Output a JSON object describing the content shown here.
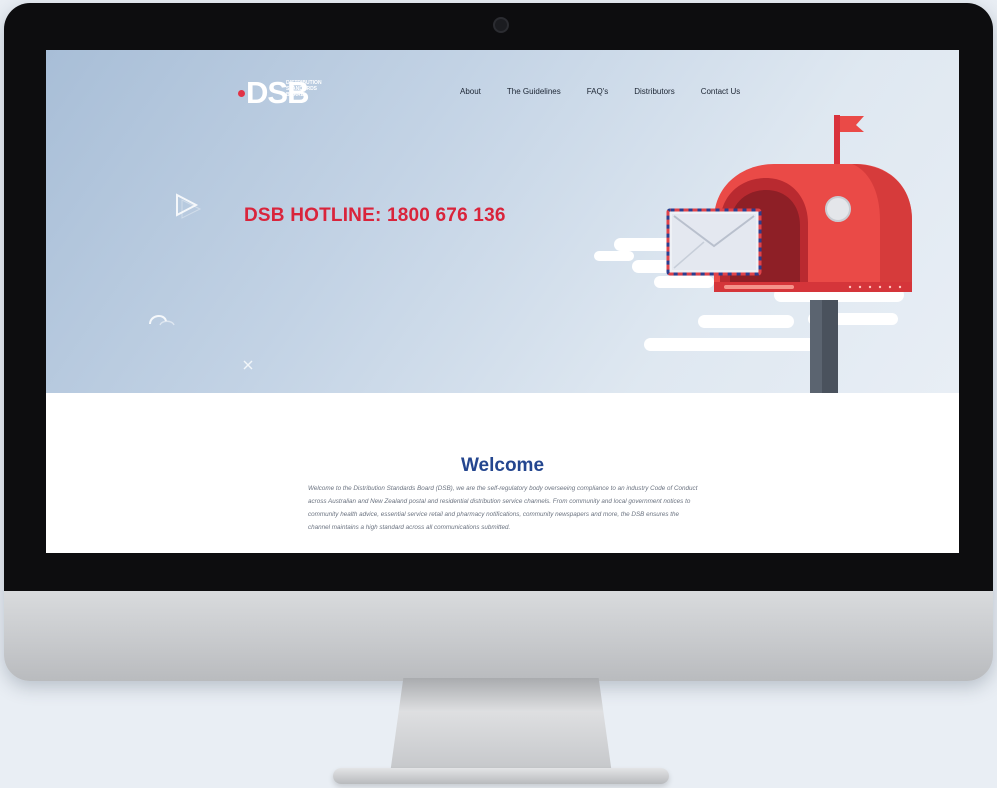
{
  "site": {
    "logo": {
      "mark": "DSB",
      "subtitle_lines": [
        "DISTRIBUTION",
        "STANDARDS",
        "BOARD"
      ]
    },
    "nav": [
      {
        "label": "About"
      },
      {
        "label": "The Guidelines"
      },
      {
        "label": "FAQ's"
      },
      {
        "label": "Distributors"
      },
      {
        "label": "Contact Us"
      }
    ],
    "hero": {
      "hotline": "DSB HOTLINE: 1800 676 136"
    },
    "welcome": {
      "title": "Welcome",
      "body": "Welcome to the Distribution Standards Board (DSB), we are the self-regulatory body overseeing compliance to an industry Code of Conduct across Australian and New Zealand postal and residential distribution service channels. From community and local government notices to community health advice, essential service retail and pharmacy notifications, community newspapers and more, the DSB ensures the channel maintains a high standard across all communications submitted."
    }
  },
  "colors": {
    "accent_red": "#d9243b",
    "heading_blue": "#24468f",
    "mailbox_red": "#e9443f",
    "bezel": "#0d0d0f"
  },
  "icons": [
    "play-outline-icon",
    "close-x-icon",
    "swirl-icon",
    "mailbox-illustration"
  ]
}
